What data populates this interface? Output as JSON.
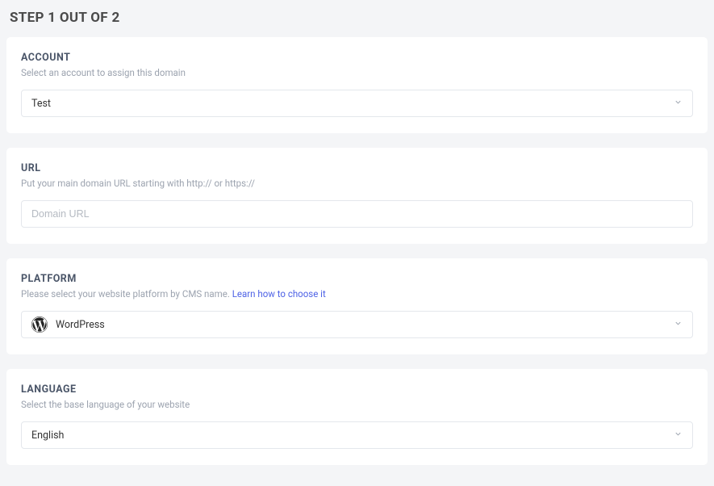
{
  "page": {
    "title": "STEP 1 OUT OF 2"
  },
  "account": {
    "title": "ACCOUNT",
    "help": "Select an account to assign this domain",
    "value": "Test"
  },
  "url": {
    "title": "URL",
    "help": "Put your main domain URL starting with http:// or https://",
    "placeholder": "Domain URL",
    "value": ""
  },
  "platform": {
    "title": "PLATFORM",
    "help_prefix": "Please select your website platform by CMS name.  ",
    "help_link": "Learn how to choose it",
    "value": "WordPress",
    "icon": "wordpress-icon"
  },
  "language": {
    "title": "LANGUAGE",
    "help": "Select the base language of your website",
    "value": "English"
  }
}
